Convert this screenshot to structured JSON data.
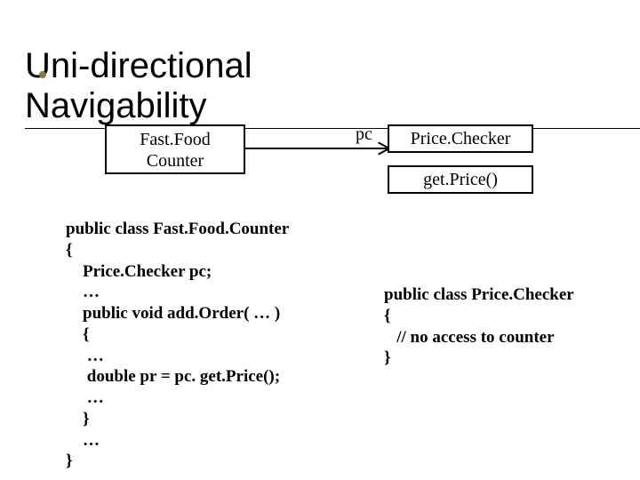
{
  "title": "Uni-directional Navigability",
  "uml": {
    "left_class": {
      "line1": "Fast.Food",
      "line2": "Counter"
    },
    "role_label": "pc",
    "right_class": {
      "name": "Price.Checker",
      "method": "get.Price()"
    }
  },
  "code_left": "public class Fast.Food.Counter\n{\n    Price.Checker pc;\n    …\n    public void add.Order( … )\n    {\n     …\n     double pr = pc. get.Price();\n     …\n    }\n    …\n}",
  "code_right": "public class Price.Checker\n{\n   // no access to counter\n}",
  "chart_data": {
    "type": "diagram",
    "kind": "uml-association",
    "classes": [
      {
        "name": "FastFoodCounter",
        "attributes": [],
        "methods": []
      },
      {
        "name": "PriceChecker",
        "attributes": [],
        "methods": [
          "getPrice()"
        ]
      }
    ],
    "associations": [
      {
        "from": "FastFoodCounter",
        "to": "PriceChecker",
        "navigable_to": true,
        "navigable_from": false,
        "role_to": "pc"
      }
    ]
  }
}
